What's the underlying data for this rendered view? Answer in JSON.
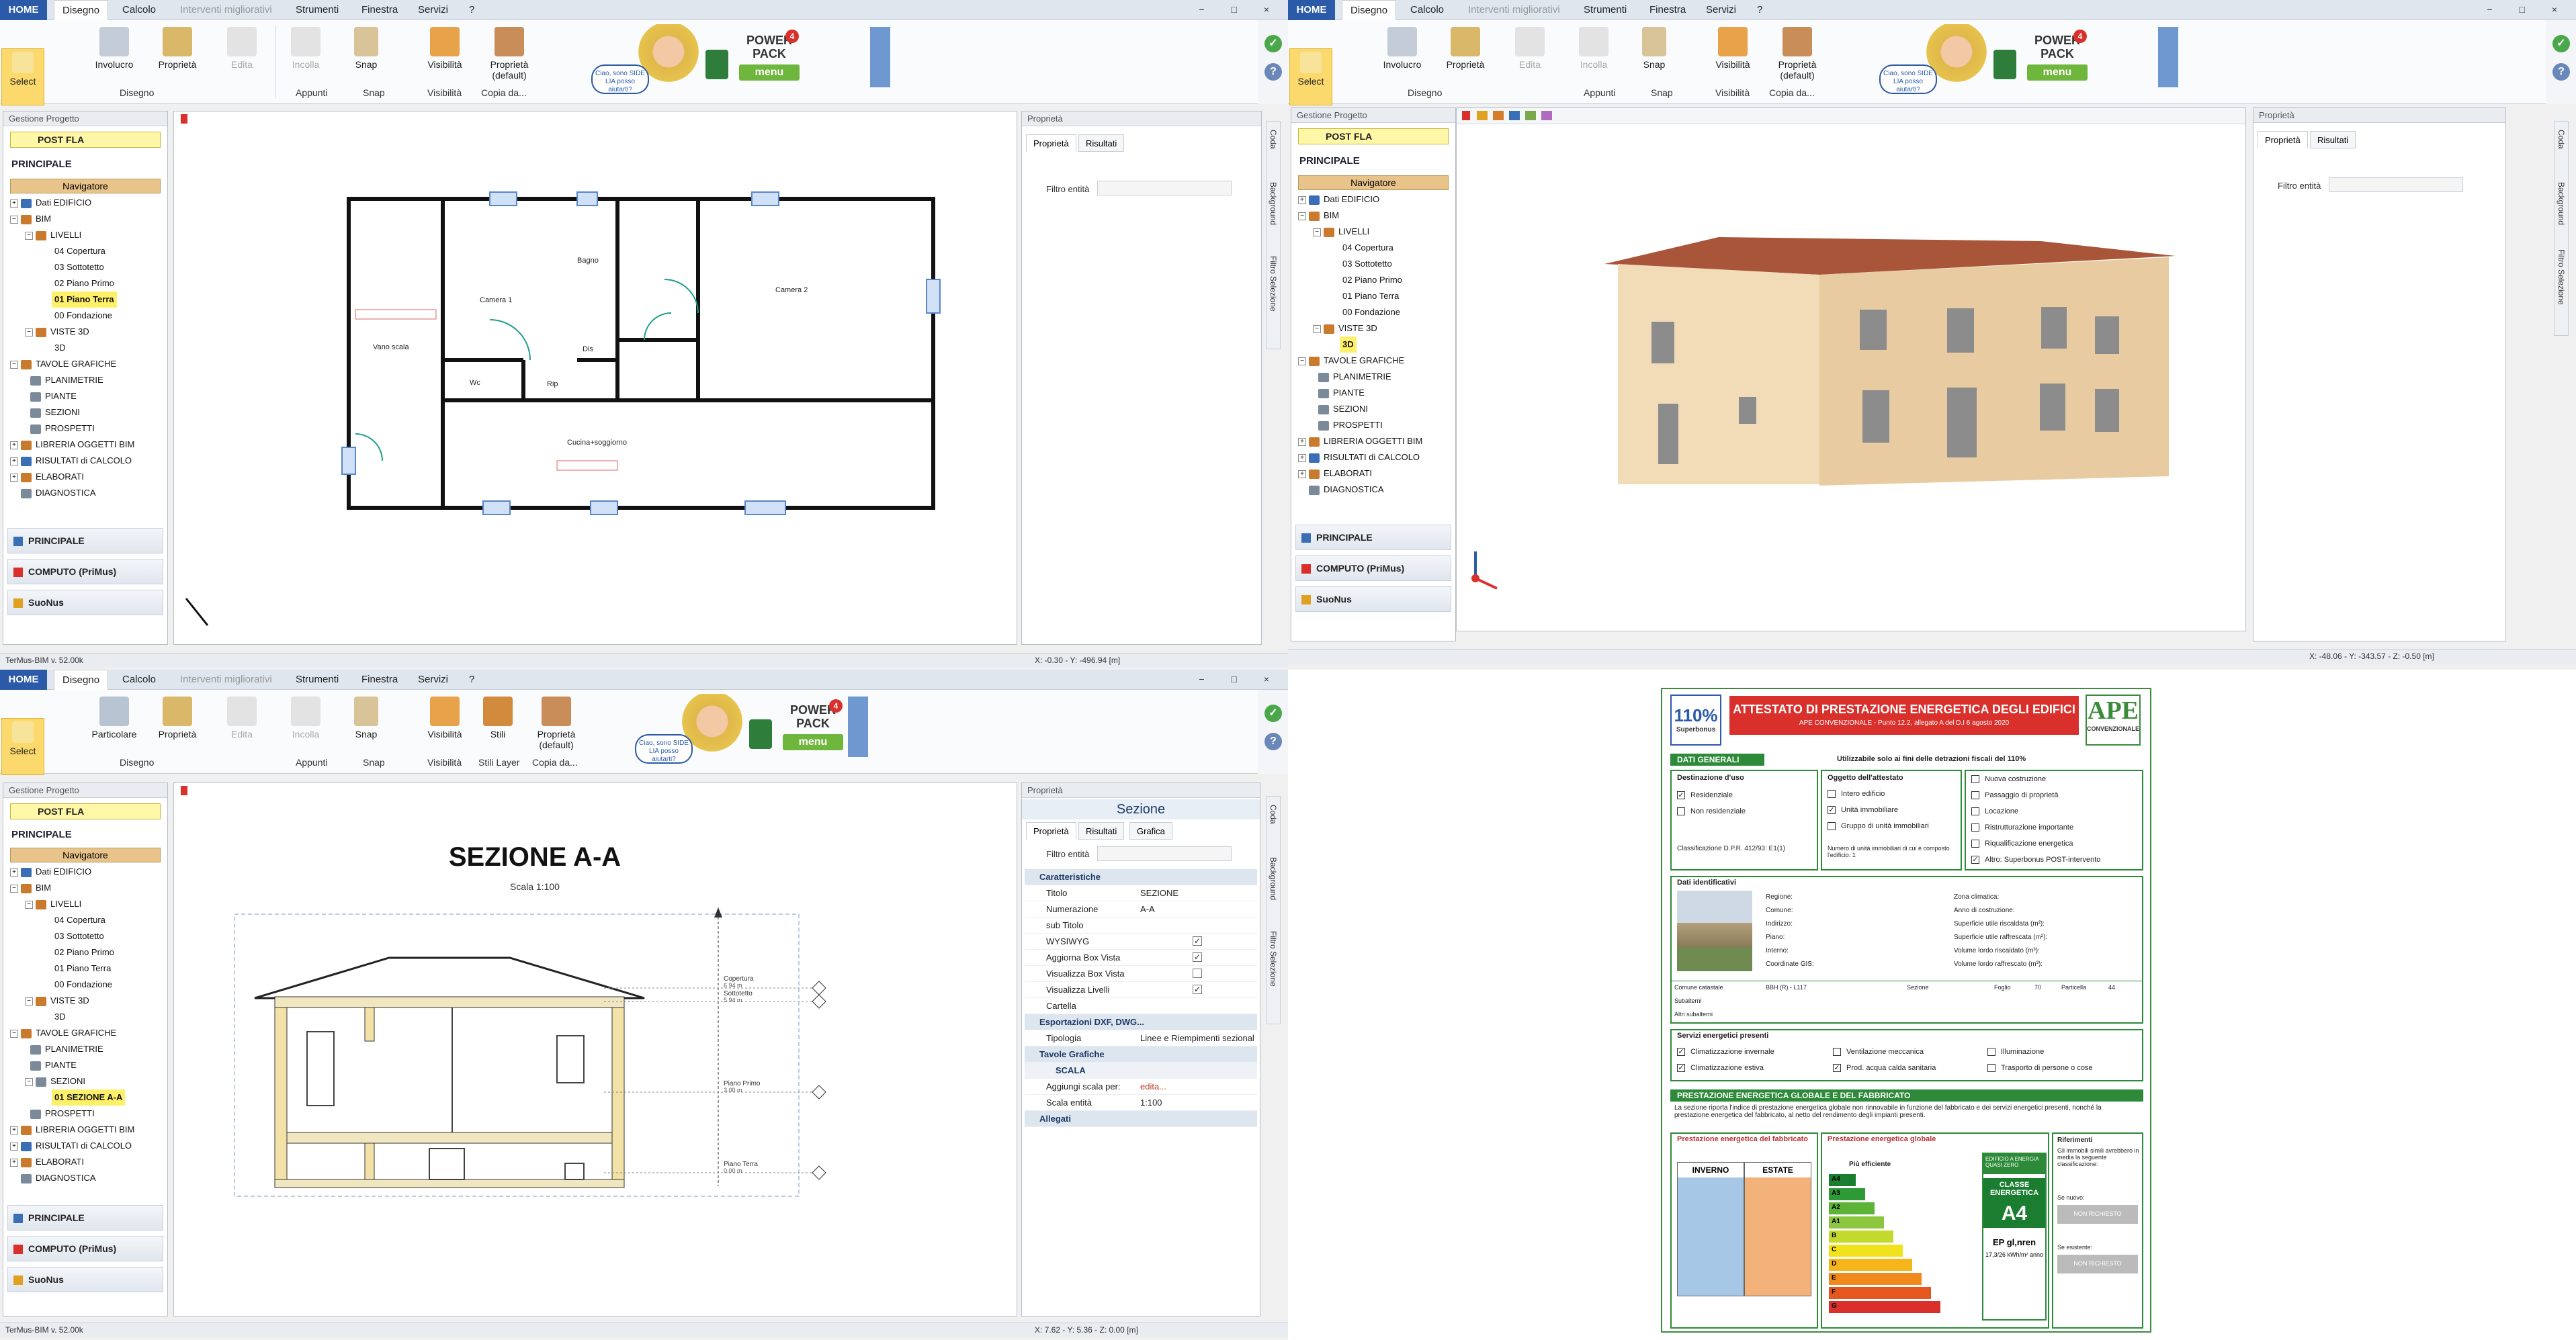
{
  "app": {
    "tabs": [
      "HOME",
      "Disegno",
      "Calcolo",
      "Interventi migliorativi",
      "Strumenti",
      "Finestra",
      "Servizi",
      "?"
    ],
    "active_tab": "Disegno",
    "win_controls": "− □ ×",
    "version": "TerMus-BIM v. 52.00k",
    "promo_bubble": "Ciao, sono SIDE LIA posso aiutarti?",
    "powerpack": {
      "line1": "POWER",
      "line2": "PACK",
      "menu": "menu",
      "badge": "4"
    },
    "side_labels": [
      "Coda",
      "Background",
      "Filtro Selezione"
    ]
  },
  "ribbon_a": {
    "buttons": [
      "Select",
      "Involucro",
      "Proprietà",
      "Edita",
      "Incolla",
      "Snap",
      "Visibilità",
      "Proprietà (default)"
    ],
    "groups": [
      "Disegno",
      "Appunti",
      "Snap",
      "Visibilità",
      "Copia da..."
    ]
  },
  "ribbon_b": {
    "buttons": [
      "Select",
      "Particolare",
      "Proprietà",
      "Edita",
      "Incolla",
      "Snap",
      "Visibilità",
      "Stili",
      "Proprietà (default)"
    ],
    "groups": [
      "Disegno",
      "Appunti",
      "Snap",
      "Visibilità",
      "Stili Layer",
      "Copia da..."
    ]
  },
  "project": {
    "panel_title": "Gestione Progetto",
    "name": "POST FLA",
    "section": "PRINCIPALE",
    "navigator": "Navigatore",
    "tree_plan": [
      "Dati EDIFICIO",
      "BIM",
      "LIVELLI",
      "04 Copertura",
      "03 Sottotetto",
      "02 Piano Primo",
      "01 Piano Terra",
      "00 Fondazione",
      "VISTE 3D",
      "3D",
      "TAVOLE GRAFICHE",
      "PLANIMETRIE",
      "PIANTE",
      "SEZIONI",
      "PROSPETTI",
      "LIBRERIA OGGETTI BIM",
      "RISULTATI di CALCOLO",
      "ELABORATI",
      "DIAGNOSTICA"
    ],
    "tree_section": [
      "Dati EDIFICIO",
      "BIM",
      "LIVELLI",
      "04 Copertura",
      "03 Sottotetto",
      "02 Piano Primo",
      "01 Piano Terra",
      "00 Fondazione",
      "VISTE 3D",
      "3D",
      "TAVOLE GRAFICHE",
      "PLANIMETRIE",
      "PIANTE",
      "SEZIONI",
      "01 SEZIONE A-A",
      "PROSPETTI",
      "LIBRERIA OGGETTI BIM",
      "RISULTATI di CALCOLO",
      "ELABORATI",
      "DIAGNOSTICA"
    ],
    "acc": [
      "PRINCIPALE",
      "COMPUTO (PriMus)",
      "SuoNus"
    ]
  },
  "props": {
    "title": "Proprietà",
    "tabs": [
      "Proprietà",
      "Risultati",
      "Grafica"
    ],
    "filter": "Filtro entità",
    "sezione_header": "Sezione",
    "rows": [
      {
        "t": "cat",
        "k": "Caratteristiche"
      },
      {
        "k": "Titolo",
        "v": "SEZIONE"
      },
      {
        "k": "Numerazione",
        "v": "A-A"
      },
      {
        "k": "sub Titolo",
        "v": ""
      },
      {
        "k": "WYSIWYG",
        "v": "",
        "c": "✓"
      },
      {
        "k": "Aggiorna Box Vista",
        "v": "",
        "c": "✓"
      },
      {
        "k": "Visualizza Box Vista",
        "v": "",
        "c": ""
      },
      {
        "k": "Visualizza Livelli",
        "v": "",
        "c": "✓"
      },
      {
        "k": "Cartella",
        "v": ""
      },
      {
        "t": "cat",
        "k": "Esportazioni DXF, DWG..."
      },
      {
        "k": "Tipologia",
        "v": "Linee e Riempimenti sezional"
      },
      {
        "t": "cat",
        "k": "Tavole Grafiche"
      },
      {
        "t": "cat",
        "k": "SCALA"
      },
      {
        "k": "Aggiungi scala per:",
        "v": "edita..."
      },
      {
        "k": "Scala entità",
        "v": "1:100"
      },
      {
        "t": "cat",
        "k": "Allegati"
      }
    ]
  },
  "plan": {
    "rooms": [
      "Vano scala",
      "Camera 1",
      "Bagno",
      "Camera 2",
      "Wc",
      "Rip",
      "Dis",
      "Cucina+soggiorno"
    ]
  },
  "section_drawing": {
    "title": "SEZIONE  A-A",
    "scale": "Scala 1:100",
    "levels": [
      "Copertura",
      "Sottotetto",
      "Piano Primo",
      "Piano Terra"
    ],
    "level_elev": [
      "6.94 m",
      "5.94 m",
      "3.00 m",
      "0.00 m"
    ]
  },
  "status": {
    "q1": "X: -0.30 - Y: -496.94 [m]",
    "q2": "X: -48.06 - Y: -343.57 - Z: -0.50 [m]",
    "q3": "X: 7.62 - Y: 5.36 - Z: 0.00 [m]"
  },
  "ape": {
    "logo_left": "110%",
    "logo_left_sub": "Superbonus",
    "title": "ATTESTATO DI PRESTAZIONE ENERGETICA DEGLI EDIFICI",
    "subtitle": "APE CONVENZIONALE - Punto 12.2, allegato A del D.I 6 agosto 2020",
    "logo_right": "APE",
    "logo_right_sub": "CONVENZIONALE",
    "dati_generali": "DATI GENERALI",
    "usable": "Utilizzabile solo ai fini delle detrazioni fiscali del 110%",
    "destinazione": "Destinazione d'uso",
    "dest_opts": [
      "Residenziale",
      "Non residenziale"
    ],
    "classificazione": "Classificazione D.P.R. 412/93: E1(1)",
    "oggetto": "Oggetto dell'attestato",
    "ogg_opts": [
      "Intero edificio",
      "Unità immobiliare",
      "Gruppo di unità immobiliari"
    ],
    "numero_unita": "Numero di unità immobiliari di cui è composto l'edificio: 1",
    "motivi": [
      "Nuova costruzione",
      "Passaggio di proprietà",
      "Locazione",
      "Ristrutturazione importante",
      "Riqualificazione energetica",
      "Altro: Superbonus POST-intervento"
    ],
    "dati_ident": "Dati identificativi",
    "ident_left": [
      "Regione:",
      "Comune:",
      "Indirizzo:",
      "Piano:",
      "Interno:",
      "Coordinate GIS:"
    ],
    "ident_right": [
      "Zona climatica:",
      "Anno di costruzione:",
      "Superficie utile riscaldata (m²):",
      "Superficie utile raffrescata (m²):",
      "Volume lordo riscaldato (m³):",
      "Volume lordo raffrescato (m³):"
    ],
    "catasto": [
      "Comune catastale",
      "Sezione",
      "Foglio",
      "Particella",
      "Subalterni",
      "Altri subalterni"
    ],
    "catasto_vals": [
      "BBH (R) - L117",
      "70",
      "44"
    ],
    "servizi": "Servizi energetici presenti",
    "serv_opts": [
      "Climatizzazione invernale",
      "Climatizzazione estiva",
      "Ventilazione meccanica",
      "Prod. acqua calda sanitaria",
      "Illuminazione",
      "Trasporto di persone o cose"
    ],
    "prest_title": "PRESTAZIONE ENERGETICA GLOBALE E DEL FABBRICATO",
    "prest_text": "La sezione riporta l'indice di prestazione energetica globale non rinnovabile in funzione del fabbricato e dei servizi energetici presenti, nonché la prestazione energetica del fabbricato, al netto del rendimento degli impianti presenti.",
    "fabbricato": "Prestazione energetica del fabbricato",
    "inverno": "INVERNO",
    "estate": "ESTATE",
    "globale": "Prestazione energetica globale",
    "piu_eff": "Più efficiente",
    "nzeb": "EDIFICIO A ENERGIA QUASI ZERO",
    "classe": "CLASSE ENERGETICA",
    "classe_val": "A4",
    "ep": "EP gl,nren",
    "ep_val": "17,3/26 kWh/m² anno",
    "rif_title": "Riferimenti",
    "rif_text": "Gli immobili simili avrebbero in media la seguente classificazione:",
    "se_nuovo": "Se nuovo:",
    "se_esistente": "Se esistente:",
    "non_richiesto": "NON RICHIESTO",
    "classes": [
      "A4",
      "A3",
      "A2",
      "A1",
      "B",
      "C",
      "D",
      "E",
      "F",
      "G"
    ],
    "class_colors": [
      "#1a7d2f",
      "#2d9a36",
      "#5cb338",
      "#8cc63f",
      "#c4d92e",
      "#f2e21c",
      "#f7b51c",
      "#f08a1c",
      "#e5571f",
      "#d9302c"
    ]
  },
  "colors": {
    "accent": "#2a5aa8",
    "select": "#fcd96c",
    "navigator": "#e8c48b",
    "project": "#fff7a8",
    "ape_green": "#2d8a39",
    "ape_red": "#d9302c"
  }
}
